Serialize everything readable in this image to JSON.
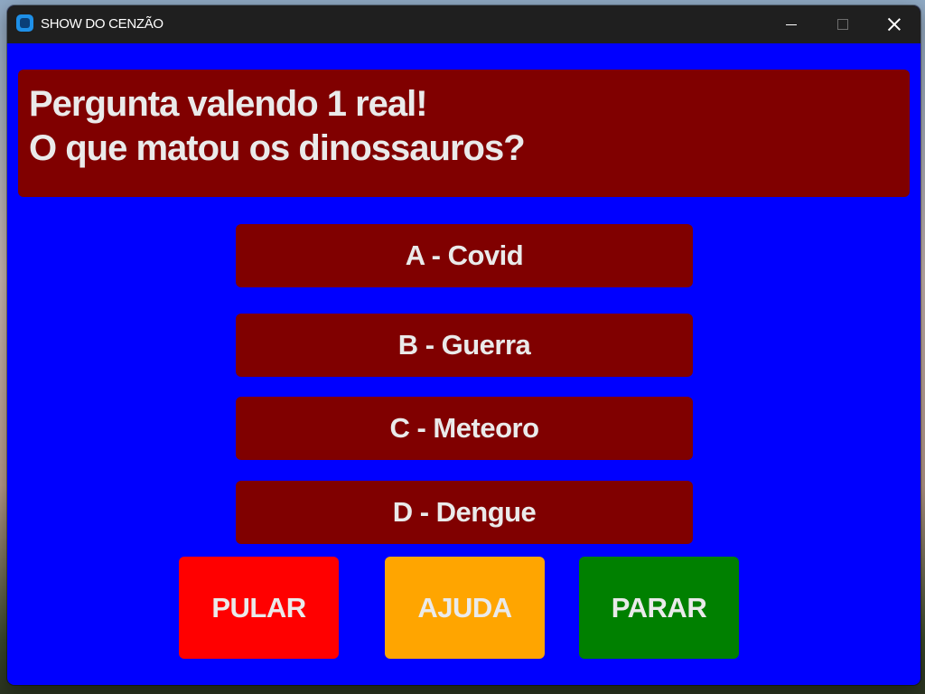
{
  "window": {
    "title": "SHOW DO CENZÃO",
    "background_color": "#0000ff"
  },
  "question": {
    "line1": "Pergunta valendo 1 real!",
    "line2": "O que matou os dinossauros?",
    "box_color": "#800000"
  },
  "answers": [
    {
      "label": "A - Covid"
    },
    {
      "label": "B - Guerra"
    },
    {
      "label": "C - Meteoro"
    },
    {
      "label": "D - Dengue"
    }
  ],
  "actions": {
    "skip": {
      "label": "PULAR",
      "color": "#ff0000"
    },
    "help": {
      "label": "AJUDA",
      "color": "#ffa500"
    },
    "stop": {
      "label": "PARAR",
      "color": "#008000"
    }
  },
  "icons": {
    "app": "app-icon",
    "minimize": "minimize-icon",
    "maximize": "maximize-icon",
    "close": "close-icon"
  }
}
